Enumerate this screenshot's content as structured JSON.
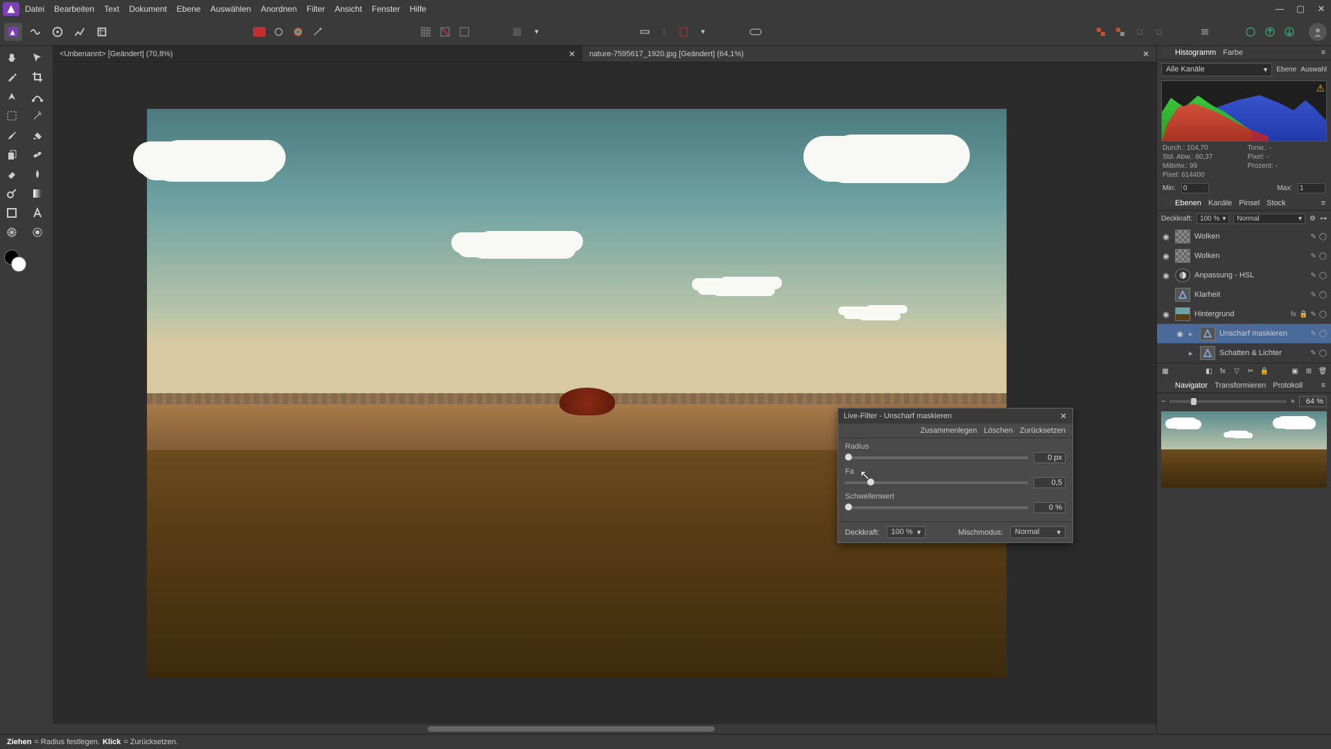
{
  "menu": [
    "Datei",
    "Bearbeiten",
    "Text",
    "Dokument",
    "Ebene",
    "Auswählen",
    "Anordnen",
    "Filter",
    "Ansicht",
    "Fenster",
    "Hilfe"
  ],
  "tabs": [
    {
      "label": "<Unbenannt> [Geändert] (70,8%)",
      "active": true
    },
    {
      "label": "nature-7595617_1920.jpg [Geändert] (64,1%)",
      "active": false
    }
  ],
  "histogram": {
    "tabs": [
      "Histogramm",
      "Farbe"
    ],
    "channel_label": "Alle Kanäle",
    "btn_layer": "Ebene",
    "btn_selection": "Auswahl",
    "stats": {
      "durch": "Durch.: 104,70",
      "tonw": "Tonw.: -",
      "std": "Std. Abw.: 80,37",
      "pixel2": "Pixel: -",
      "mittelw": "Mittelw.: 99",
      "prozent": "Prozent: -",
      "pixel": "Pixel: 614400"
    },
    "min_label": "Min:",
    "min_val": "0",
    "max_label": "Max:",
    "max_val": "1"
  },
  "layers_panel": {
    "tabs": [
      "Ebenen",
      "Kanäle",
      "Pinsel",
      "Stock"
    ],
    "opacity_label": "Deckkraft:",
    "opacity_val": "100 %",
    "blend": "Normal",
    "layers": [
      {
        "name": "Wolken",
        "type": "checker",
        "visible": true
      },
      {
        "name": "Wolken",
        "type": "checker",
        "visible": true
      },
      {
        "name": "Anpassung - HSL",
        "type": "adj",
        "visible": true
      },
      {
        "name": "Klarheit",
        "type": "tri",
        "visible": false
      },
      {
        "name": "Hintergrund",
        "type": "img",
        "visible": true,
        "badges": [
          "fx",
          "lock"
        ]
      },
      {
        "name": "Unscharf maskieren",
        "type": "tri",
        "selected": true,
        "child": true
      },
      {
        "name": "Schatten & Lichter",
        "type": "tri",
        "child": true,
        "visible": false
      }
    ]
  },
  "navigator": {
    "tabs": [
      "Navigator",
      "Transformieren",
      "Protokoll"
    ],
    "zoom": "64 %"
  },
  "dialog": {
    "title": "Live-Filter - Unscharf maskieren",
    "actions": [
      "Zusammenlegen",
      "Löschen",
      "Zurücksetzen"
    ],
    "radius_label": "Radius",
    "radius_val": "0 px",
    "factor_label": "Fa",
    "factor_val": "0,5",
    "threshold_label": "Schwellenwert",
    "threshold_val": "0 %",
    "opacity_label": "Deckkraft:",
    "opacity_val": "100 %",
    "blend_label": "Mischmodus:",
    "blend_val": "Normal"
  },
  "status": {
    "drag": "Ziehen",
    "drag_txt": " = Radius festlegen. ",
    "click": "Klick",
    "click_txt": " = Zurücksetzen."
  }
}
